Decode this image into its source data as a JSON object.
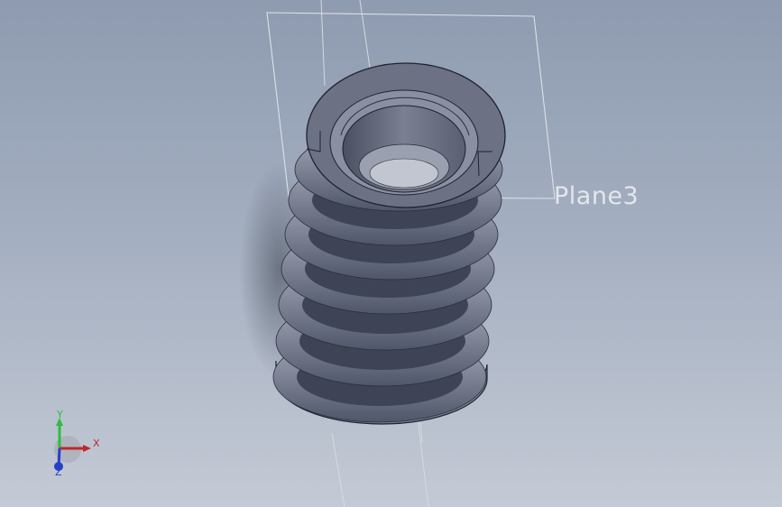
{
  "viewport": {
    "plane_label": "Plane3",
    "background_top": "#8e9bb0",
    "background_bottom": "#c4cad5"
  },
  "model": {
    "part": "compression-spring",
    "coil_color": "#6e7486",
    "shadow": true,
    "visible_coils": 8
  },
  "triad": {
    "x_label": "X",
    "y_label": "Y",
    "z_label": "Z",
    "x_color": "#c0282a",
    "y_color": "#2bbf3a",
    "z_color": "#2a3fc8"
  }
}
